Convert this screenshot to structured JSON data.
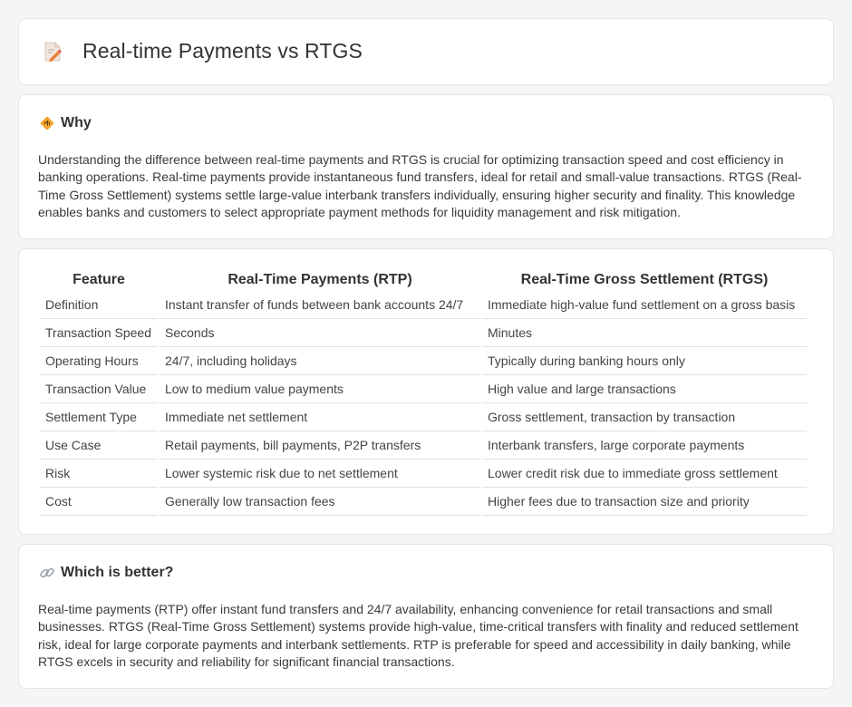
{
  "header": {
    "title": "Real-time Payments vs RTGS",
    "icon": "document-edit-icon"
  },
  "why": {
    "title": "Why",
    "icon": "diamond-signal-icon",
    "text": "Understanding the difference between real-time payments and RTGS is crucial for optimizing transaction speed and cost efficiency in banking operations. Real-time payments provide instantaneous fund transfers, ideal for retail and small-value transactions. RTGS (Real-Time Gross Settlement) systems settle large-value interbank transfers individually, ensuring higher security and finality. This knowledge enables banks and customers to select appropriate payment methods for liquidity management and risk mitigation."
  },
  "comparison": {
    "headers": [
      "Feature",
      "Real-Time Payments (RTP)",
      "Real-Time Gross Settlement (RTGS)"
    ],
    "rows": [
      [
        "Definition",
        "Instant transfer of funds between bank accounts 24/7",
        "Immediate high-value fund settlement on a gross basis"
      ],
      [
        "Transaction Speed",
        "Seconds",
        "Minutes"
      ],
      [
        "Operating Hours",
        "24/7, including holidays",
        "Typically during banking hours only"
      ],
      [
        "Transaction Value",
        "Low to medium value payments",
        "High value and large transactions"
      ],
      [
        "Settlement Type",
        "Immediate net settlement",
        "Gross settlement, transaction by transaction"
      ],
      [
        "Use Case",
        "Retail payments, bill payments, P2P transfers",
        "Interbank transfers, large corporate payments"
      ],
      [
        "Risk",
        "Lower systemic risk due to net settlement",
        "Lower credit risk due to immediate gross settlement"
      ],
      [
        "Cost",
        "Generally low transaction fees",
        "Higher fees due to transaction size and priority"
      ]
    ]
  },
  "better": {
    "title": "Which is better?",
    "icon": "link-icon",
    "text": "Real-time payments (RTP) offer instant fund transfers and 24/7 availability, enhancing convenience for retail transactions and small businesses. RTGS (Real-Time Gross Settlement) systems provide high-value, time-critical transfers with finality and reduced settlement risk, ideal for large corporate payments and interbank settlements. RTP is preferable for speed and accessibility in daily banking, while RTGS excels in security and reliability for significant financial transactions."
  }
}
